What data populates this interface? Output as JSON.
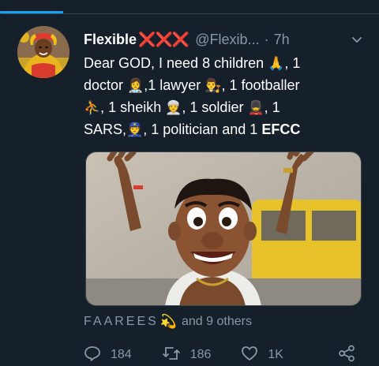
{
  "tweet": {
    "display_name": "Flexible",
    "name_emoji": "❌❌❌",
    "handle": "@Flexib...",
    "separator": "·",
    "time": "7h",
    "text": {
      "line1_a": "Dear GOD, I need 8 children",
      "emoji_pray": "🙏",
      "line1_b": ", 1",
      "line2_a": "doctor",
      "emoji_doctor": "👩‍⚕️",
      "line2_b": ",1 lawyer",
      "emoji_lawyer": "👨‍⚖️",
      "line2_c": ", 1 footballer",
      "emoji_footballer": "⛹",
      "line3_a": ", 1 sheikh",
      "emoji_sheikh": "👳",
      "line3_b": ", 1 soldier",
      "emoji_soldier": "💂",
      "line3_c": ", 1",
      "line4_a": "SARS,",
      "emoji_police": "👮",
      "line4_b": ", 1 politician and 1",
      "line4_bold": "EFCC"
    },
    "likers": {
      "name": "FAAREES",
      "emoji": "💫",
      "suffix": "and 9 others"
    },
    "actions": {
      "reply_count": "184",
      "retweet_count": "186",
      "like_count": "1K"
    }
  },
  "colors": {
    "background": "#15202b",
    "accent": "#1da1f2",
    "secondary_text": "#8899a6",
    "name_emoji": "#e0245e"
  },
  "icons": {
    "caret": "chevron-down-icon",
    "reply": "reply-icon",
    "retweet": "retweet-icon",
    "like": "heart-icon",
    "share": "share-icon"
  }
}
